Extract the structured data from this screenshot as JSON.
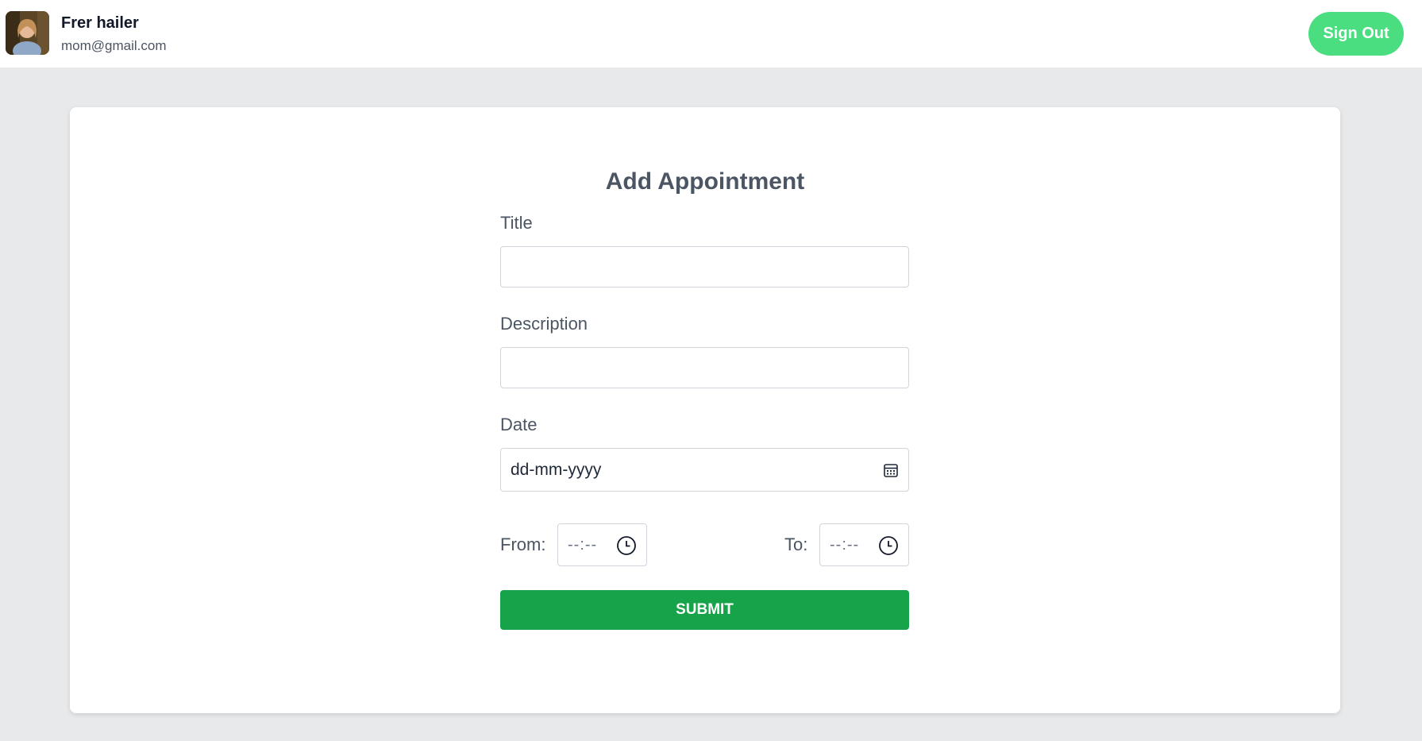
{
  "header": {
    "user_name": "Frer hailer",
    "user_email": "mom@gmail.com",
    "sign_out_label": "Sign Out",
    "sign_out_color": "#4ade80"
  },
  "form": {
    "title": "Add Appointment",
    "fields": {
      "title_label": "Title",
      "title_value": "",
      "description_label": "Description",
      "description_value": "",
      "date_label": "Date",
      "date_placeholder": "dd-mm-yyyy",
      "from_label": "From:",
      "from_placeholder": "--:--",
      "to_label": "To:",
      "to_placeholder": "--:--"
    },
    "submit_label": "SUBMIT",
    "submit_color": "#16a34a"
  },
  "icons": {
    "date_icon": "calendar-icon",
    "time_icon": "clock-icon"
  }
}
